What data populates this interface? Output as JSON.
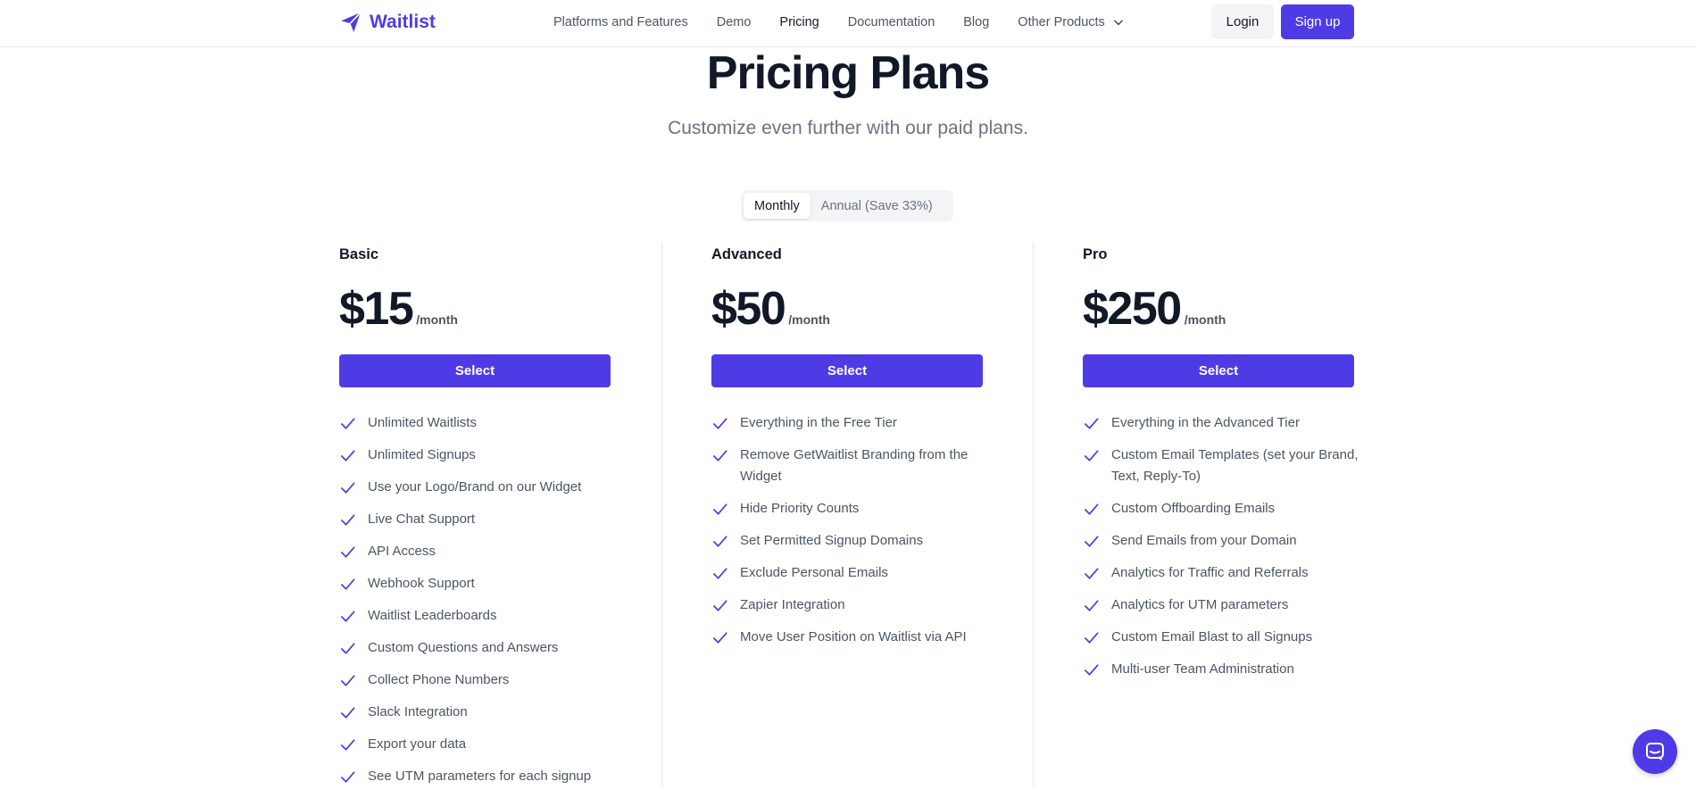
{
  "nav": {
    "brand": "Waitlist",
    "links": [
      {
        "label": "Platforms and Features"
      },
      {
        "label": "Demo"
      },
      {
        "label": "Pricing",
        "active": true
      },
      {
        "label": "Documentation"
      },
      {
        "label": "Blog"
      },
      {
        "label": "Other Products"
      }
    ],
    "login_label": "Login",
    "signup_label": "Sign up"
  },
  "hero": {
    "title": "Pricing Plans",
    "subtitle": "Customize even further with our paid plans."
  },
  "billing_toggle": {
    "monthly_label": "Monthly",
    "annual_label": "Annual (Save 33%)",
    "selected": "Monthly"
  },
  "plans": [
    {
      "name": "Basic",
      "price": "$15",
      "period": "/month",
      "button_label": "Select",
      "features": [
        "Unlimited Waitlists",
        "Unlimited Signups",
        "Use your Logo/Brand on our Widget",
        "Live Chat Support",
        "API Access",
        "Webhook Support",
        "Waitlist Leaderboards",
        "Custom Questions and Answers",
        "Collect Phone Numbers",
        "Slack Integration",
        "Export your data",
        "See UTM parameters for each signup"
      ]
    },
    {
      "name": "Advanced",
      "price": "$50",
      "period": "/month",
      "button_label": "Select",
      "features": [
        "Everything in the Free Tier",
        "Remove GetWaitlist Branding from the Widget",
        "Hide Priority Counts",
        "Set Permitted Signup Domains",
        "Exclude Personal Emails",
        "Zapier Integration",
        "Move User Position on Waitlist via API"
      ]
    },
    {
      "name": "Pro",
      "price": "$250",
      "period": "/month",
      "button_label": "Select",
      "features": [
        "Everything in the Advanced Tier",
        "Custom Email Templates (set your Brand, Text, Reply-To)",
        "Custom Offboarding Emails",
        "Send Emails from your Domain",
        "Analytics for Traffic and Referrals",
        "Analytics for UTM parameters",
        "Custom Email Blast to all Signups",
        "Multi-user Team Administration"
      ]
    }
  ],
  "colors": {
    "accent": "#4f3be6",
    "text_dark": "#111827",
    "text_muted": "#4b5563"
  },
  "icons": {
    "brand": "paper-plane-icon",
    "dropdown": "chevron-down-icon",
    "feature": "check-icon",
    "chat": "chat-icon"
  }
}
